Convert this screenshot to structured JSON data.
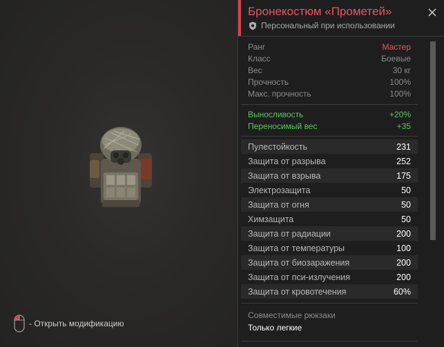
{
  "colors": {
    "accent": "#e0404c",
    "rank": "#ea5560",
    "bonus": "#5ec65e",
    "value": "#ffffff",
    "label": "#8d8d8d"
  },
  "hint": {
    "icon": "mouse-icon",
    "text": "- Открыть модификацию"
  },
  "panel": {
    "title": "Бронекостюм «Прометей»",
    "subtitle": "Персональный при использовании",
    "subtitle_icon": "shield-icon",
    "close_icon": "close-icon",
    "base_stats": [
      {
        "label": "Ранг",
        "value": "Мастер"
      },
      {
        "label": "Класс",
        "value": "Боевые"
      },
      {
        "label": "Вес",
        "value": "30 кг"
      },
      {
        "label": "Прочность",
        "value": "100%"
      },
      {
        "label": "Макс. прочность",
        "value": "100%"
      }
    ],
    "bonuses": [
      {
        "label": "Выносливость",
        "value": "+20%"
      },
      {
        "label": "Переносимый вес",
        "value": "+35"
      }
    ],
    "protection": [
      {
        "label": "Пулестойкость",
        "value": "231"
      },
      {
        "label": "Защита от разрыва",
        "value": "252"
      },
      {
        "label": "Защита от взрыва",
        "value": "175"
      },
      {
        "label": "Электрозащита",
        "value": "50"
      },
      {
        "label": "Защита от огня",
        "value": "50"
      },
      {
        "label": "Химзащита",
        "value": "50"
      },
      {
        "label": "Защита от радиации",
        "value": "200"
      },
      {
        "label": "Защита от температуры",
        "value": "100"
      },
      {
        "label": "Защита от биозаражения",
        "value": "200"
      },
      {
        "label": "Защита от пси-излучения",
        "value": "200"
      },
      {
        "label": "Защита от кровотечения",
        "value": "60%"
      }
    ],
    "compat": {
      "label": "Совместимые рюкзаки",
      "value": "Только легкие"
    }
  }
}
